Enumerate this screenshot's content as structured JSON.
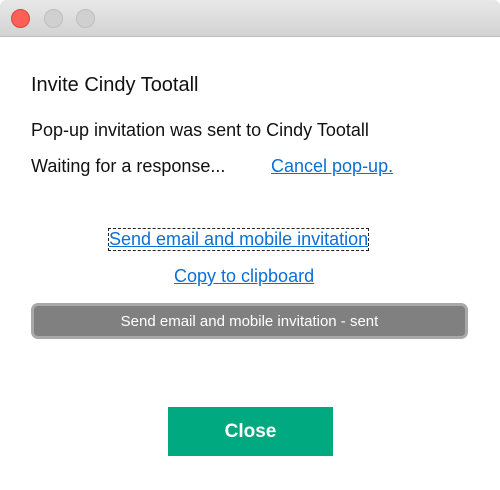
{
  "dialog": {
    "title": "Invite Cindy Tootall",
    "status": "Pop-up invitation was sent to Cindy Tootall",
    "waiting": "Waiting for a response...",
    "cancel_link": "Cancel pop-up.",
    "send_link": "Send email and mobile invitation",
    "copy_link": "Copy to clipboard",
    "sent_button": "Send email and mobile invitation - sent",
    "close_button": "Close"
  }
}
